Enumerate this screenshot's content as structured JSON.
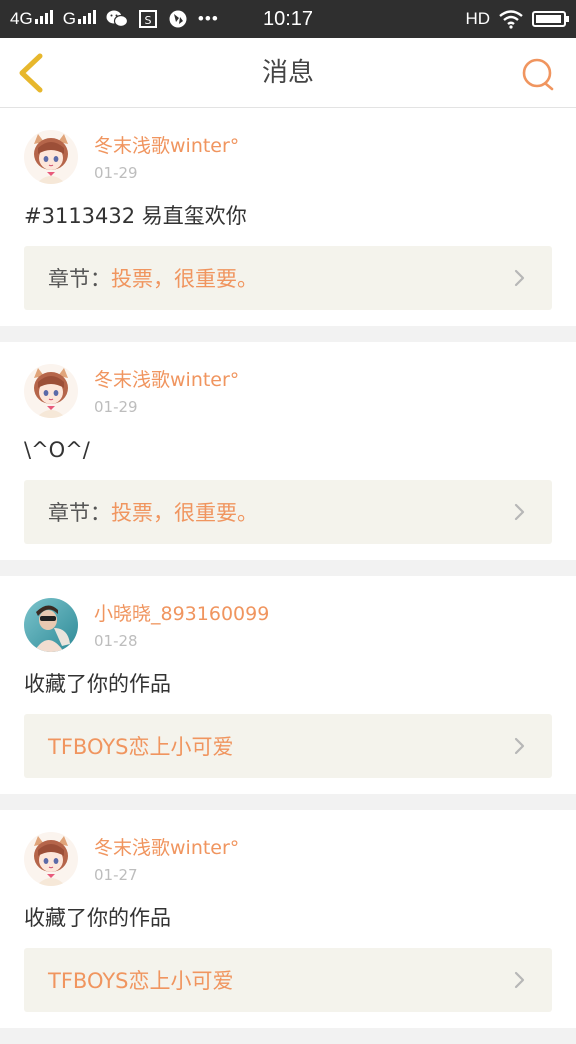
{
  "status_bar": {
    "network_1": "4G",
    "network_2": "G",
    "time": "10:17",
    "hd": "HD",
    "battery_level": 0.95
  },
  "header": {
    "title": "消息"
  },
  "colors": {
    "accent": "#f0955f",
    "ref_bg": "#f4f3ec",
    "date": "#bdbdbd"
  },
  "messages": [
    {
      "user": "冬末浅歌winter°",
      "date": "01-29",
      "content": "#3113432 易直玺欢你",
      "ref_prefix": "章节：",
      "ref_text": "投票，很重要。",
      "avatar": "anime-girl-avatar"
    },
    {
      "user": "冬末浅歌winter°",
      "date": "01-29",
      "content": "\\^O^/",
      "ref_prefix": "章节：",
      "ref_text": "投票，很重要。",
      "avatar": "anime-girl-avatar"
    },
    {
      "user": "小晓晓_893160099",
      "date": "01-28",
      "content": "收藏了你的作品",
      "ref_prefix": "",
      "ref_text": "TFBOYS恋上小可爱",
      "avatar": "photo-avatar"
    },
    {
      "user": "冬末浅歌winter°",
      "date": "01-27",
      "content": "收藏了你的作品",
      "ref_prefix": "",
      "ref_text": "TFBOYS恋上小可爱",
      "avatar": "anime-girl-avatar"
    }
  ]
}
